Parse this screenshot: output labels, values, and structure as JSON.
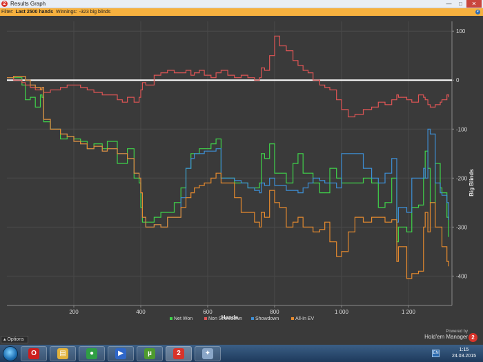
{
  "window": {
    "title": "Results Graph",
    "app_icon_label": "2",
    "minimize_glyph": "—",
    "maximize_glyph": "□",
    "close_glyph": "✕"
  },
  "filterbar": {
    "filter_label": "Filter:",
    "filter_value": "Last 2500 hands",
    "winnings_label": "Winnings:",
    "winnings_value": "-323 big blinds",
    "expand_glyph": "▾"
  },
  "bottom": {
    "options_label": "Options",
    "options_glyph": "▴",
    "powered_by": "Powered by",
    "product": "Hold'em Manager",
    "badge": "2"
  },
  "taskbar": {
    "items": [
      {
        "name": "opera",
        "glyph": "O",
        "color": "#cc1e1e"
      },
      {
        "name": "file-explorer",
        "glyph": "▤",
        "color": "#e2b23b"
      },
      {
        "name": "chrome",
        "glyph": "●",
        "color": "#2f9e44"
      },
      {
        "name": "media",
        "glyph": "▶",
        "color": "#2f67c8"
      },
      {
        "name": "utorrent",
        "glyph": "µ",
        "color": "#4d9a2e"
      },
      {
        "name": "holdem-manager",
        "glyph": "2",
        "color": "#d8332a"
      },
      {
        "name": "misc-app",
        "glyph": "✦",
        "color": "#8aa6c7"
      }
    ],
    "lang": "EN",
    "time": "1:15",
    "date": "24.03.2015"
  },
  "chart_data": {
    "type": "line",
    "xlabel": "Hands",
    "ylabel": "Big Blinds",
    "xlim": [
      0,
      1330
    ],
    "ylim": [
      -460,
      120
    ],
    "xticks": [
      {
        "v": 200,
        "label": "200"
      },
      {
        "v": 400,
        "label": "400"
      },
      {
        "v": 600,
        "label": "600"
      },
      {
        "v": 800,
        "label": "800"
      },
      {
        "v": 1000,
        "label": "1 000"
      },
      {
        "v": 1200,
        "label": "1 200"
      }
    ],
    "yticks": [
      {
        "v": 100,
        "label": "100"
      },
      {
        "v": 0,
        "label": "0"
      },
      {
        "v": -100,
        "label": "-100"
      },
      {
        "v": -200,
        "label": "-200"
      },
      {
        "v": -300,
        "label": "-300"
      },
      {
        "v": -400,
        "label": "-400"
      }
    ],
    "zero_line": 0,
    "legend_position": "bottom-center",
    "grid": true,
    "series": [
      {
        "name": "Net Won",
        "color": "#3fd44a",
        "x": [
          0,
          20,
          45,
          55,
          70,
          85,
          100,
          105,
          110,
          130,
          160,
          180,
          200,
          220,
          240,
          260,
          285,
          300,
          330,
          345,
          360,
          380,
          395,
          400,
          405,
          415,
          440,
          460,
          480,
          500,
          520,
          535,
          550,
          560,
          575,
          590,
          610,
          625,
          640,
          660,
          680,
          700,
          720,
          740,
          755,
          760,
          770,
          785,
          800,
          815,
          835,
          855,
          870,
          885,
          900,
          915,
          935,
          950,
          965,
          985,
          1000,
          1020,
          1040,
          1065,
          1090,
          1110,
          1130,
          1150,
          1165,
          1170,
          1195,
          1210,
          1230,
          1245,
          1250,
          1258,
          1265,
          1280,
          1295,
          1300,
          1315,
          1320
        ],
        "y": [
          5,
          5,
          -10,
          -40,
          -35,
          -55,
          -30,
          -35,
          -85,
          -100,
          -120,
          -115,
          -120,
          -125,
          -140,
          -130,
          -140,
          -125,
          -170,
          -170,
          -140,
          -200,
          -210,
          -260,
          -290,
          -290,
          -280,
          -270,
          -270,
          -250,
          -220,
          -180,
          -150,
          -150,
          -140,
          -140,
          -130,
          -120,
          -200,
          -200,
          -210,
          -210,
          -220,
          -220,
          -210,
          -150,
          -160,
          -130,
          -190,
          -190,
          -210,
          -170,
          -150,
          -190,
          -190,
          -210,
          -230,
          -230,
          -180,
          -200,
          -210,
          -210,
          -210,
          -200,
          -210,
          -260,
          -250,
          -200,
          -330,
          -300,
          -310,
          -260,
          -255,
          -200,
          -145,
          -180,
          -250,
          -170,
          -220,
          -230,
          -280,
          -320
        ]
      },
      {
        "name": "Non Showdown",
        "color": "#e05555",
        "x": [
          0,
          20,
          45,
          55,
          70,
          85,
          100,
          105,
          110,
          130,
          160,
          180,
          200,
          220,
          240,
          260,
          285,
          300,
          330,
          345,
          360,
          380,
          395,
          400,
          405,
          415,
          440,
          460,
          480,
          500,
          520,
          535,
          550,
          560,
          575,
          590,
          610,
          625,
          640,
          660,
          680,
          700,
          720,
          740,
          755,
          760,
          770,
          785,
          800,
          815,
          835,
          855,
          870,
          885,
          900,
          915,
          935,
          950,
          965,
          985,
          1000,
          1020,
          1040,
          1065,
          1090,
          1110,
          1130,
          1150,
          1165,
          1170,
          1195,
          1210,
          1230,
          1245,
          1250,
          1258,
          1265,
          1280,
          1295,
          1300,
          1315,
          1320
        ],
        "y": [
          5,
          0,
          -5,
          -10,
          -15,
          -20,
          -20,
          -15,
          -25,
          -20,
          -15,
          -10,
          -10,
          -15,
          -20,
          -25,
          -30,
          -30,
          -40,
          -45,
          -35,
          -45,
          -35,
          -20,
          -5,
          -10,
          10,
          15,
          20,
          15,
          15,
          20,
          10,
          15,
          20,
          10,
          5,
          15,
          20,
          10,
          5,
          10,
          5,
          0,
          5,
          25,
          20,
          50,
          90,
          70,
          60,
          40,
          30,
          20,
          15,
          0,
          -10,
          -15,
          -20,
          -40,
          -60,
          -75,
          -70,
          -60,
          -55,
          -45,
          -50,
          -40,
          -30,
          -35,
          -40,
          -45,
          -30,
          -35,
          -40,
          -50,
          -55,
          -50,
          -45,
          -40,
          -30,
          -35
        ]
      },
      {
        "name": "Showdown",
        "color": "#3d8fd6",
        "x": [
          0,
          20,
          45,
          55,
          70,
          85,
          100,
          105,
          110,
          130,
          160,
          180,
          200,
          220,
          240,
          260,
          285,
          300,
          330,
          345,
          360,
          380,
          395,
          400,
          405,
          415,
          440,
          460,
          480,
          500,
          520,
          535,
          550,
          560,
          575,
          590,
          610,
          625,
          640,
          660,
          680,
          700,
          720,
          740,
          755,
          760,
          770,
          785,
          800,
          815,
          835,
          855,
          870,
          885,
          900,
          915,
          935,
          950,
          965,
          985,
          1000,
          1020,
          1040,
          1065,
          1090,
          1110,
          1130,
          1150,
          1165,
          1170,
          1195,
          1210,
          1230,
          1245,
          1250,
          1258,
          1265,
          1280,
          1295,
          1300,
          1315,
          1320
        ],
        "y": [
          5,
          8,
          8,
          0,
          -10,
          -15,
          -20,
          -15,
          -80,
          -100,
          -110,
          -115,
          -125,
          -130,
          -140,
          -135,
          -145,
          -140,
          -150,
          -150,
          -160,
          -190,
          -200,
          -230,
          -280,
          -300,
          -295,
          -300,
          -280,
          -280,
          -240,
          -180,
          -160,
          -150,
          -150,
          -145,
          -145,
          -140,
          -200,
          -200,
          -205,
          -210,
          -220,
          -225,
          -230,
          -210,
          -215,
          -200,
          -215,
          -215,
          -225,
          -225,
          -230,
          -220,
          -210,
          -200,
          -205,
          -210,
          -210,
          -220,
          -150,
          -150,
          -150,
          -180,
          -200,
          -210,
          -190,
          -160,
          -290,
          -260,
          -270,
          -200,
          -200,
          -180,
          -200,
          -100,
          -110,
          -210,
          -230,
          -235,
          -250,
          -285
        ]
      },
      {
        "name": "All-In EV",
        "color": "#e68a2e",
        "x": [
          0,
          20,
          45,
          55,
          70,
          85,
          100,
          105,
          110,
          130,
          160,
          180,
          200,
          220,
          240,
          260,
          285,
          300,
          330,
          345,
          360,
          380,
          395,
          400,
          405,
          415,
          440,
          460,
          480,
          500,
          520,
          535,
          550,
          560,
          575,
          590,
          610,
          625,
          640,
          660,
          680,
          700,
          720,
          740,
          755,
          760,
          770,
          785,
          800,
          815,
          835,
          855,
          870,
          885,
          900,
          915,
          935,
          950,
          965,
          985,
          1000,
          1020,
          1040,
          1065,
          1090,
          1110,
          1130,
          1150,
          1165,
          1170,
          1195,
          1210,
          1230,
          1245,
          1250,
          1258,
          1265,
          1280,
          1295,
          1300,
          1315,
          1320
        ],
        "y": [
          5,
          8,
          8,
          0,
          -10,
          -15,
          -20,
          -15,
          -80,
          -100,
          -110,
          -115,
          -125,
          -130,
          -140,
          -135,
          -145,
          -140,
          -150,
          -150,
          -160,
          -190,
          -200,
          -230,
          -280,
          -300,
          -295,
          -300,
          -280,
          -280,
          -260,
          -240,
          -230,
          -220,
          -215,
          -210,
          -200,
          -190,
          -210,
          -210,
          -240,
          -270,
          -270,
          -290,
          -300,
          -270,
          -280,
          -225,
          -250,
          -260,
          -300,
          -290,
          -280,
          -300,
          -300,
          -310,
          -305,
          -290,
          -330,
          -360,
          -350,
          -310,
          -280,
          -290,
          -280,
          -280,
          -290,
          -285,
          -370,
          -340,
          -405,
          -395,
          -390,
          -300,
          -270,
          -310,
          -250,
          -300,
          -300,
          -340,
          -370,
          -380
        ]
      }
    ]
  }
}
